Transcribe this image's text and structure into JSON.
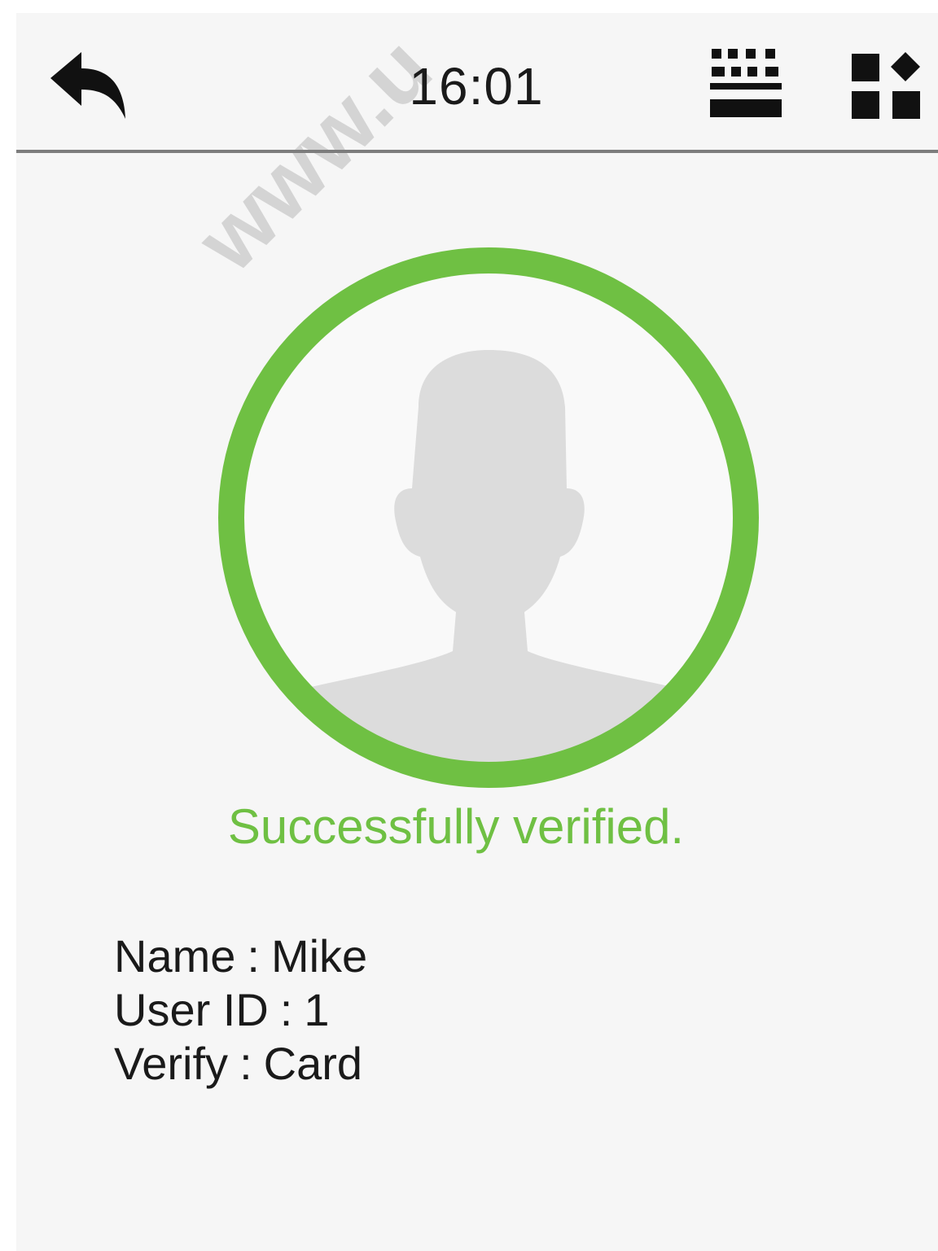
{
  "header": {
    "time": "16:01",
    "back_icon": "back-arrow-icon",
    "keyboard_icon": "keypad-icon",
    "shortcut_icon": "shortcut-grid-icon"
  },
  "watermark": {
    "text": "www.u"
  },
  "verification": {
    "status_text": "Successfully verified.",
    "status_color": "#6fc043",
    "avatar_icon": "user-avatar-icon"
  },
  "user_info": {
    "name_label": "Name",
    "name_value": "Mike",
    "user_id_label": "User ID",
    "user_id_value": "1",
    "verify_label": "Verify",
    "verify_value": "Card",
    "separator": ":"
  },
  "colors": {
    "background": "#f6f6f6",
    "accent_green": "#6fc043",
    "icon_dark": "#111111",
    "avatar_gray": "#dcdcdc"
  }
}
